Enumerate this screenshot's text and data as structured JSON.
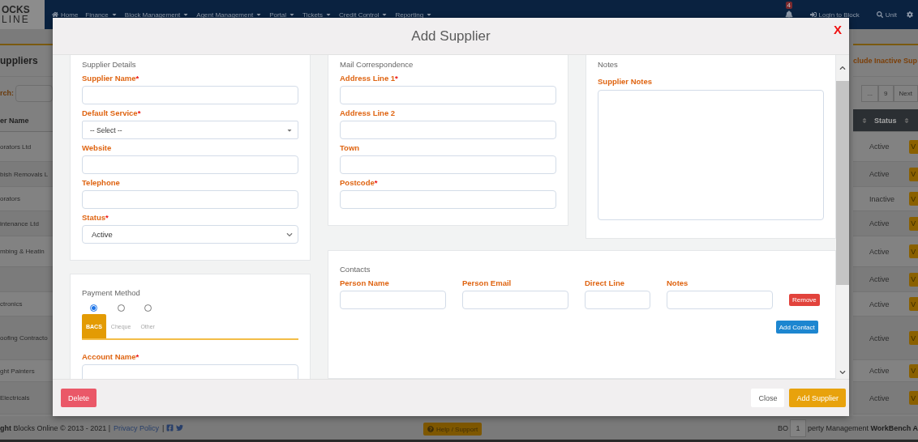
{
  "navbar": {
    "logo": [
      "OCKS",
      "LINE"
    ],
    "menu": [
      {
        "label": "Home"
      },
      {
        "label": "Finance",
        "dropdown": true
      },
      {
        "label": "Block Management",
        "dropdown": true
      },
      {
        "label": "Agent Management",
        "dropdown": true
      },
      {
        "label": "Portal",
        "dropdown": true
      },
      {
        "label": "Tickets",
        "dropdown": true
      },
      {
        "label": "Credit Control",
        "dropdown": true
      },
      {
        "label": "Reporting",
        "dropdown": true
      }
    ],
    "notifications": {
      "count": "4"
    },
    "actions": [
      {
        "label": "Login to Block"
      },
      {
        "label": "Unit"
      }
    ]
  },
  "page": {
    "heading": "uppliers",
    "search_label": "rch:",
    "include_inactive": "clude Inactive Sup",
    "pagination": [
      "...",
      "9",
      "Next"
    ],
    "columns": [
      "er Name",
      "Status"
    ],
    "rows": [
      {
        "name": "orators Ltd",
        "status": "Active",
        "action": "V"
      },
      {
        "name": "bish Removals L",
        "status": "Active",
        "action": "V"
      },
      {
        "name": "orators",
        "status": "Inactive",
        "action": "V"
      },
      {
        "name": "intenance Ltd",
        "status": "Active",
        "action": "V"
      },
      {
        "name": "mbing & Heatin",
        "status": "Active",
        "action": "V"
      },
      {
        "status": "Active",
        "action": "V"
      },
      {
        "name": "ctronics",
        "status": "Active",
        "action": "V"
      },
      {
        "name": "oofing Contracto",
        "status": "Active",
        "action": "V"
      },
      {
        "name": "ght Painters",
        "status": "Active",
        "action": "V"
      },
      {
        "name": "Electricals",
        "status": "Active",
        "action": "V"
      }
    ]
  },
  "footer": {
    "copyright": "**ght** Blocks Online © 2013 - 2021 |",
    "privacy_link": "Privacy Policy",
    "separator": "|",
    "help": "Help / Support",
    "right_prefix": "BO",
    "page_field": "1",
    "right_text": "perty Management **WorkBench A**"
  },
  "modal": {
    "title": "Add Supplier",
    "close": "X",
    "supplier_details": {
      "title": "Supplier Details",
      "fields": [
        {
          "kind": "input",
          "label": "Supplier Name",
          "mark": "*"
        },
        {
          "kind": "dropdown",
          "label": "Default Service",
          "mark": "*",
          "value": "-- Select --"
        },
        {
          "kind": "input",
          "label": "Website"
        },
        {
          "kind": "input",
          "label": "Telephone"
        },
        {
          "kind": "select",
          "label": "Status",
          "mark": "*",
          "value": "Active"
        }
      ]
    },
    "mail": {
      "title": "Mail Correspondence",
      "fields": [
        {
          "kind": "input",
          "label": "Address Line 1",
          "mark": "*"
        },
        {
          "kind": "input",
          "label": "Address Line 2"
        },
        {
          "kind": "input",
          "label": "Town"
        },
        {
          "kind": "input",
          "label": "Postcode",
          "mark": "*"
        }
      ]
    },
    "notes": {
      "title": "Notes",
      "label": "Supplier Notes"
    },
    "payment": {
      "title": "Payment Method",
      "options": [
        {
          "label": "BACS",
          "selected": true
        },
        {
          "label": "Cheque",
          "selected": false
        },
        {
          "label": "Other",
          "selected": false
        }
      ],
      "fields": [
        {
          "kind": "input",
          "label": "Account Name",
          "mark": "*"
        }
      ]
    },
    "contacts": {
      "title": "Contacts",
      "columns": [
        "Person Name",
        "Person Email",
        "Direct Line",
        "Notes"
      ],
      "remove": "Remove",
      "add": "Add Contact"
    },
    "buttons": {
      "delete": "Delete",
      "close": "Close",
      "submit": "Add Supplier"
    }
  }
}
